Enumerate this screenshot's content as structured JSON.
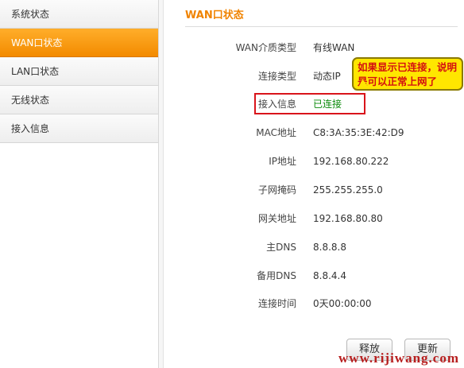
{
  "sidebar": {
    "items": [
      {
        "label": "系统状态",
        "active": false
      },
      {
        "label": "WAN口状态",
        "active": true
      },
      {
        "label": "LAN口状态",
        "active": false
      },
      {
        "label": "无线状态",
        "active": false
      },
      {
        "label": "接入信息",
        "active": false
      }
    ]
  },
  "main": {
    "title": "WAN口状态",
    "rows": [
      {
        "label": "WAN介质类型",
        "value": "有线WAN"
      },
      {
        "label": "连接类型",
        "value": "动态IP"
      },
      {
        "label": "接入信息",
        "value": "已连接"
      },
      {
        "label": "MAC地址",
        "value": "C8:3A:35:3E:42:D9"
      },
      {
        "label": "IP地址",
        "value": "192.168.80.222"
      },
      {
        "label": "子网掩码",
        "value": "255.255.255.0"
      },
      {
        "label": "网关地址",
        "value": "192.168.80.80"
      },
      {
        "label": "主DNS",
        "value": "8.8.8.8"
      },
      {
        "label": "备用DNS",
        "value": "8.8.4.4"
      },
      {
        "label": "连接时间",
        "value": "0天00:00:00"
      }
    ],
    "buttons": {
      "release": "释放",
      "renew": "更新"
    }
  },
  "callout": {
    "text": "如果显示已连接，说明是可以正常上网了"
  },
  "watermark": "www.rijiwang.com",
  "colors": {
    "accent": "#f08300",
    "connected": "#0a8a0a",
    "highlight": "#d9141b",
    "callout_bg": "#ffe600",
    "callout_text": "#d41010"
  }
}
